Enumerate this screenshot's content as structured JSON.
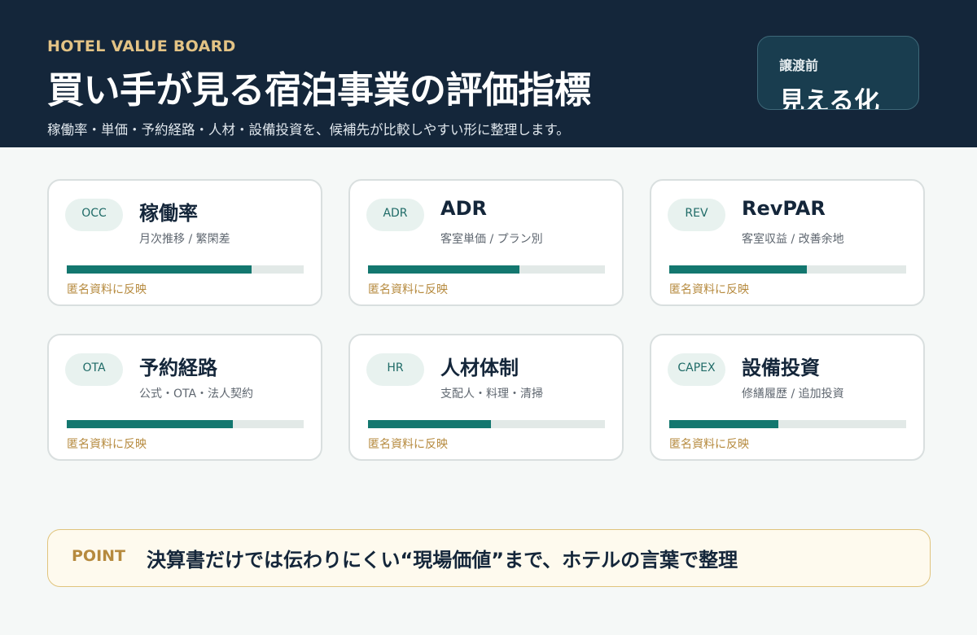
{
  "header": {
    "eyebrow": "HOTEL VALUE BOARD",
    "title": "買い手が見る宿泊事業の評価指標",
    "subtitle": "稼働率・単価・予約経路・人材・設備投資を、候補先が比較しやすい形に整理します。",
    "badge": {
      "label": "譲渡前",
      "value": "見える化"
    }
  },
  "cards": [
    {
      "tag": "OCC",
      "title": "稼働率",
      "subtitle": "月次推移 / 繁閑差",
      "progress": 0.78,
      "note": "匿名資料に反映"
    },
    {
      "tag": "ADR",
      "title": "ADR",
      "subtitle": "客室単価 / プラン別",
      "progress": 0.64,
      "note": "匿名資料に反映"
    },
    {
      "tag": "REV",
      "title": "RevPAR",
      "subtitle": "客室収益 / 改善余地",
      "progress": 0.58,
      "note": "匿名資料に反映"
    },
    {
      "tag": "OTA",
      "title": "予約経路",
      "subtitle": "公式・OTA・法人契約",
      "progress": 0.7,
      "note": "匿名資料に反映"
    },
    {
      "tag": "HR",
      "title": "人材体制",
      "subtitle": "支配人・料理・清掃",
      "progress": 0.52,
      "note": "匿名資料に反映"
    },
    {
      "tag": "CAPEX",
      "title": "設備投資",
      "subtitle": "修繕履歴 / 追加投資",
      "progress": 0.46,
      "note": "匿名資料に反映"
    }
  ],
  "point": {
    "label": "POINT",
    "text": "決算書だけでは伝わりにくい“現場価値”まで、ホテルの言葉で整理"
  },
  "colors": {
    "header_bg": "#14263a",
    "accent_teal": "#13776f",
    "accent_gold": "#b68a3e",
    "page_bg": "#f5f8f7"
  }
}
